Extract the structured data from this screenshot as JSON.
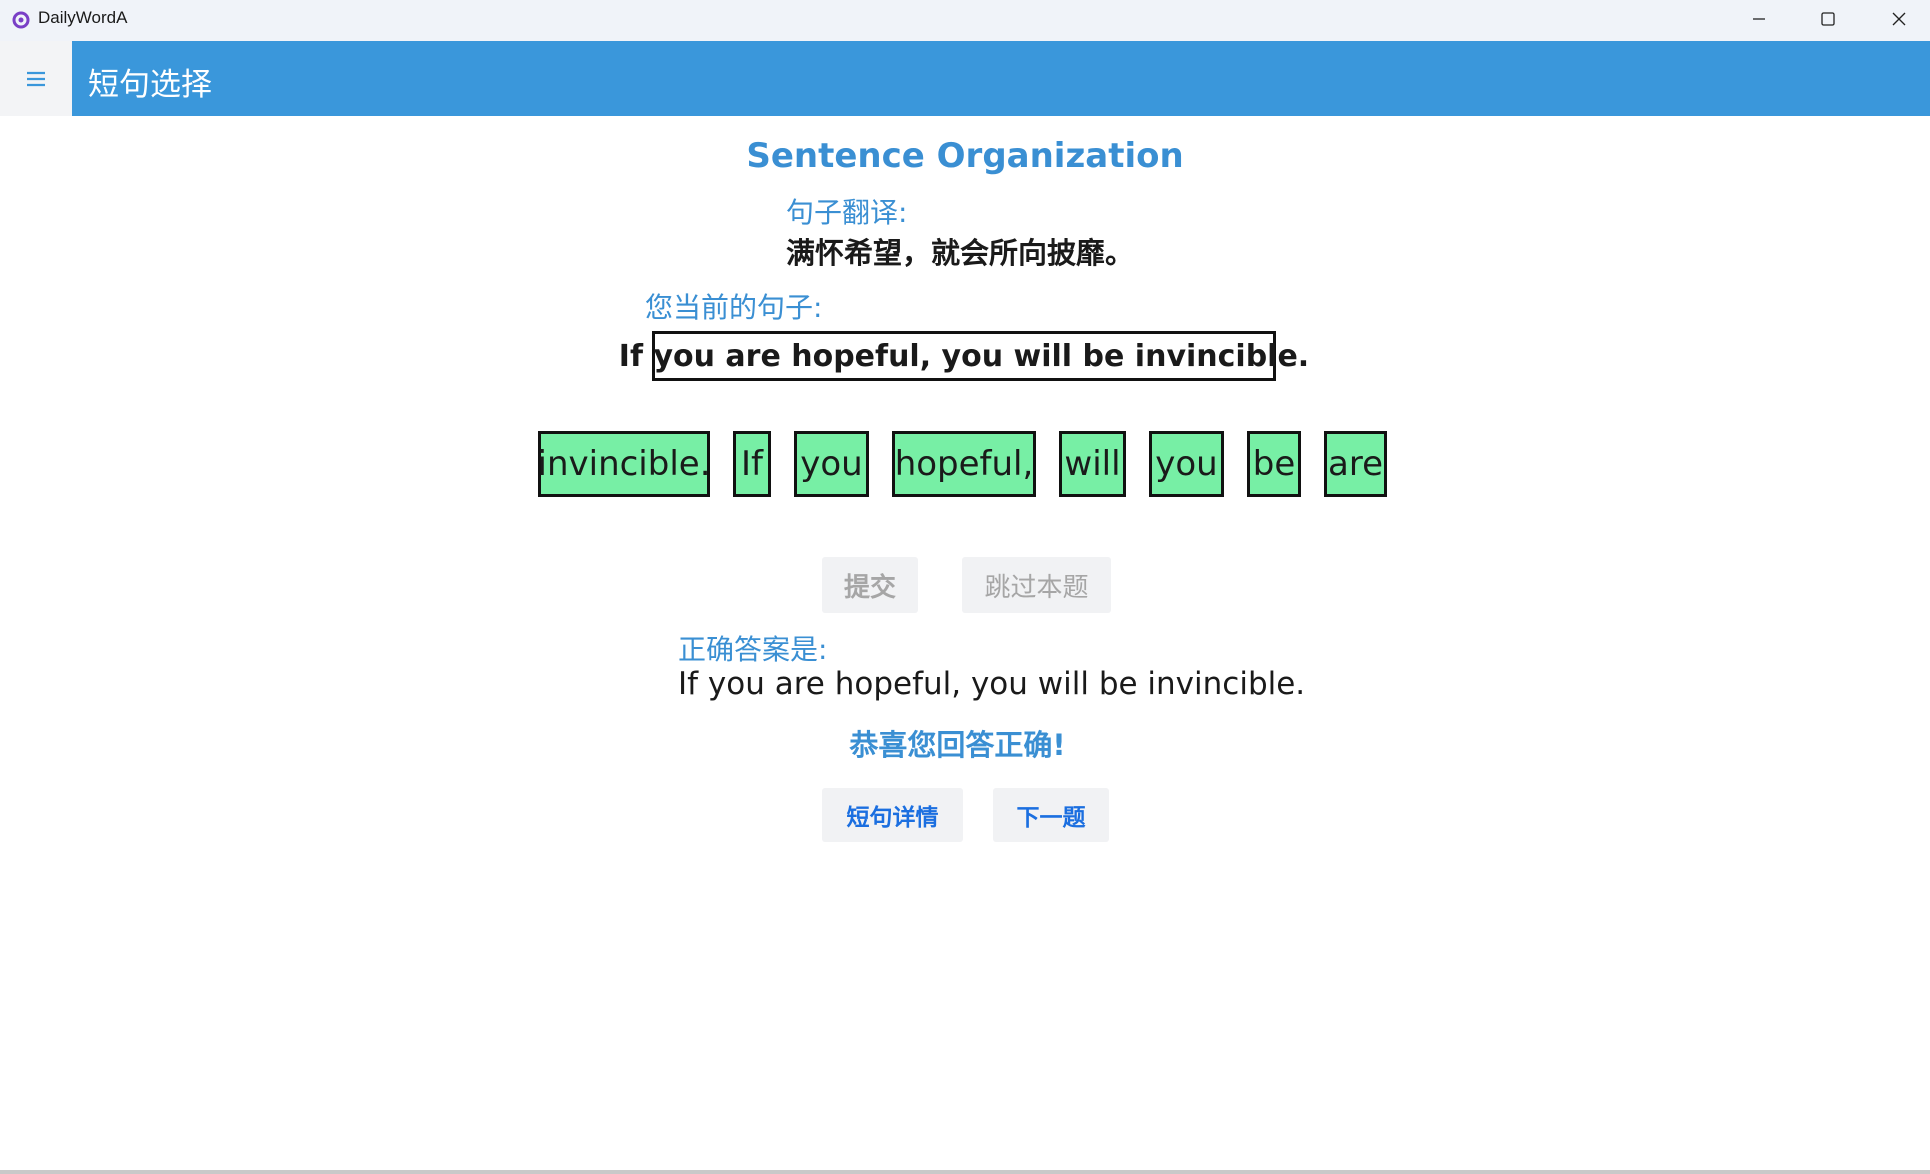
{
  "window": {
    "app_name": "DailyWordA",
    "controls": {
      "minimize": "minimize",
      "maximize": "maximize",
      "close": "close"
    }
  },
  "header": {
    "menu_icon": "hamburger-menu-icon",
    "title": "短句选择"
  },
  "main": {
    "heading": "Sentence Organization",
    "translation_label": "句子翻译:",
    "translation_text": "满怀希望，就会所向披靡。",
    "current_label": "您当前的句子:",
    "current_sentence": "If you are hopeful, you will be invincible.",
    "word_chips": [
      "invincible.",
      "If",
      "you",
      "hopeful,",
      "will",
      "you",
      "be",
      "are"
    ],
    "submit_label": "提交",
    "skip_label": "跳过本题",
    "answer_label": "正确答案是:",
    "answer_text": "If you are hopeful, you will be invincible.",
    "result_text": "恭喜您回答正确!",
    "details_label": "短句详情",
    "next_label": "下一题"
  },
  "colors": {
    "accent": "#3a97db",
    "chip_bg": "#77efa5",
    "link_blue": "#1b6fe0",
    "disabled_text": "#a6a6a6"
  }
}
